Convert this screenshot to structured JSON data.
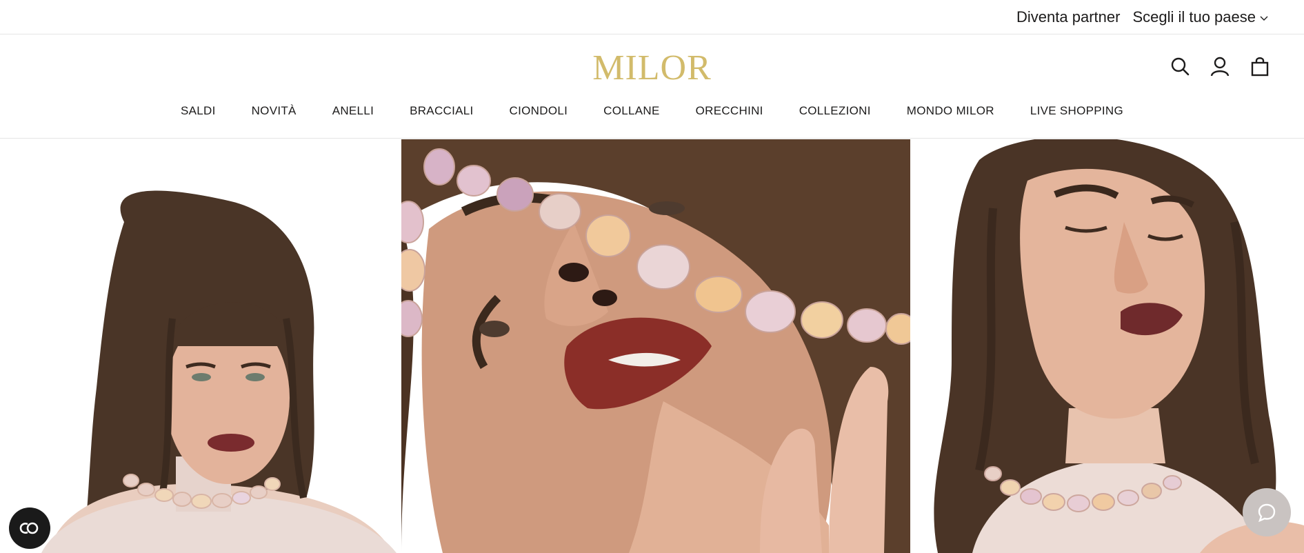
{
  "topbar": {
    "partner_label": "Diventa partner",
    "country_label": "Scegli il tuo paese"
  },
  "header": {
    "logo_text": "MILOR",
    "logo_color": "#d2bb6b",
    "icons": [
      "search-icon",
      "account-icon",
      "cart-icon"
    ]
  },
  "nav": {
    "items": [
      {
        "label": "SALDI"
      },
      {
        "label": "NOVITÀ"
      },
      {
        "label": "ANELLI"
      },
      {
        "label": "BRACCIALI"
      },
      {
        "label": "CIONDOLI"
      },
      {
        "label": "COLLANE"
      },
      {
        "label": "ORECCHINI"
      },
      {
        "label": "COLLEZIONI"
      },
      {
        "label": "MONDO MILOR"
      },
      {
        "label": "LIVE SHOPPING"
      }
    ]
  },
  "hero": {
    "panels": [
      {
        "name": "model-front-portrait"
      },
      {
        "name": "model-closeup-pearls"
      },
      {
        "name": "model-side-portrait"
      }
    ]
  },
  "floating": {
    "accessibility_icon": "accessibility-icon",
    "chat_icon": "chat-bubble-icon"
  }
}
